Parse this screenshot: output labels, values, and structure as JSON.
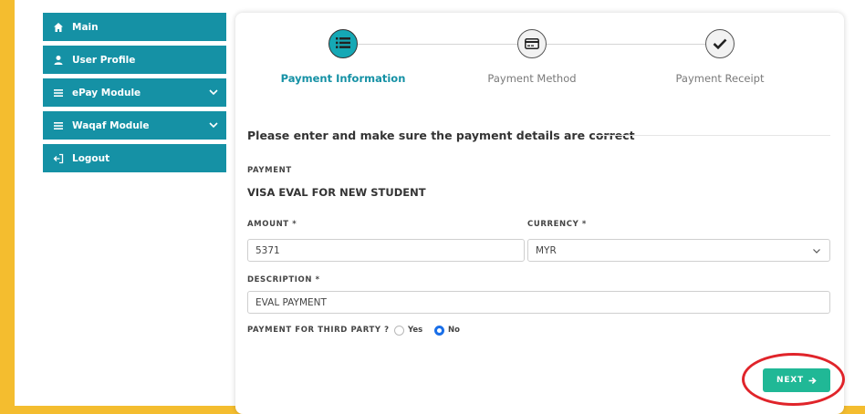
{
  "sidebar": {
    "items": [
      {
        "label": "Main",
        "icon": "home-icon"
      },
      {
        "label": "User Profile",
        "icon": "user-icon"
      },
      {
        "label": "ePay Module",
        "icon": "list-icon",
        "expandable": true
      },
      {
        "label": "Waqaf Module",
        "icon": "list-icon",
        "expandable": true
      },
      {
        "label": "Logout",
        "icon": "logout-icon"
      }
    ]
  },
  "steps": [
    {
      "label": "Payment Information",
      "icon": "list-icon",
      "active": true
    },
    {
      "label": "Payment Method",
      "icon": "credit-card-icon",
      "active": false
    },
    {
      "label": "Payment Receipt",
      "icon": "check-icon",
      "active": false
    }
  ],
  "form": {
    "heading": "Please enter and make sure the payment details are correct",
    "payment_label": "PAYMENT",
    "payment_value": "VISA EVAL FOR NEW STUDENT",
    "amount_label": "AMOUNT *",
    "amount_value": "5371",
    "currency_label": "CURRENCY *",
    "currency_value": "MYR",
    "description_label": "DESCRIPTION *",
    "description_value": "EVAL PAYMENT",
    "third_party_label": "PAYMENT FOR THIRD PARTY ?",
    "option_yes": "Yes",
    "option_no": "No",
    "selected_option": "No",
    "next_label": "NEXT"
  },
  "colors": {
    "background": "#f4bd2f",
    "sidebar": "#1591a5",
    "step_active": "#15a8b5",
    "next_button": "#20b896",
    "radio_selected": "#1a6fe8",
    "annotation": "#e0242a"
  }
}
